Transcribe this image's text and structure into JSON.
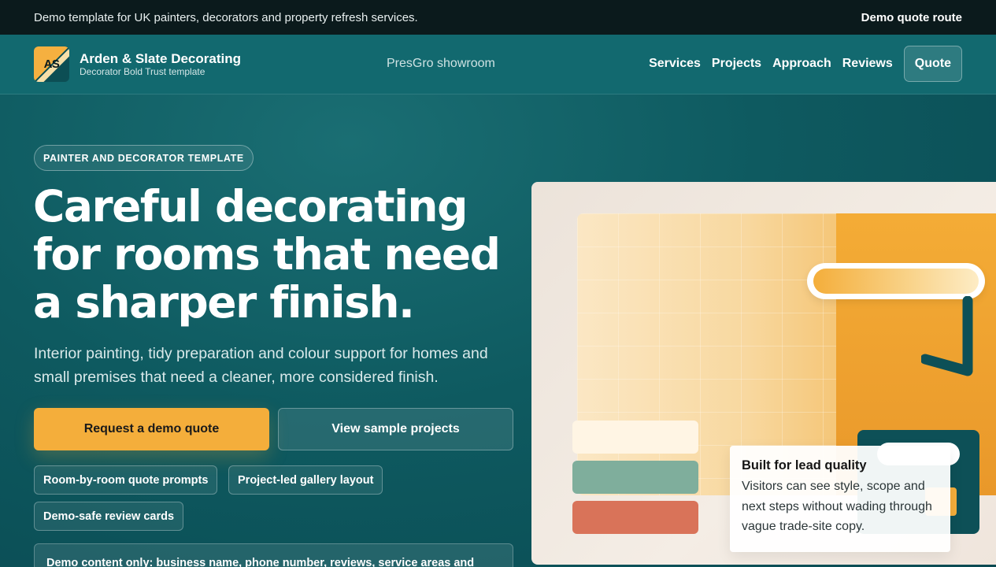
{
  "topbar": {
    "text": "Demo template for UK painters, decorators and property refresh services.",
    "link": "Demo quote route"
  },
  "header": {
    "logo_initials": "AS",
    "brand_name": "Arden & Slate Decorating",
    "brand_sub": "Decorator Bold Trust template",
    "showroom": "PresGro showroom",
    "nav": [
      "Services",
      "Projects",
      "Approach",
      "Reviews"
    ],
    "quote_label": "Quote"
  },
  "hero": {
    "eyebrow": "PAINTER AND DECORATOR TEMPLATE",
    "headline": "Careful decorating for rooms that need a sharper finish.",
    "lede": "Interior painting, tidy preparation and colour support for homes and small premises that need a cleaner, more considered finish.",
    "primary_cta": "Request a demo quote",
    "secondary_cta": "View sample projects",
    "chips": [
      "Room-by-room quote prompts",
      "Project-led gallery layout",
      "Demo-safe review cards"
    ],
    "note": "Demo content only: business name, phone number, reviews, service areas and"
  },
  "illustration": {
    "callout_title": "Built for lead quality",
    "callout_body": "Visitors can see style, scope and next steps without wading through vague trade-site copy.",
    "colors": {
      "accent": "#f4ae3b",
      "teal": "#0d5057",
      "sage": "#7fae9c",
      "terracotta": "#d97359",
      "cream": "#fff5e4"
    }
  }
}
